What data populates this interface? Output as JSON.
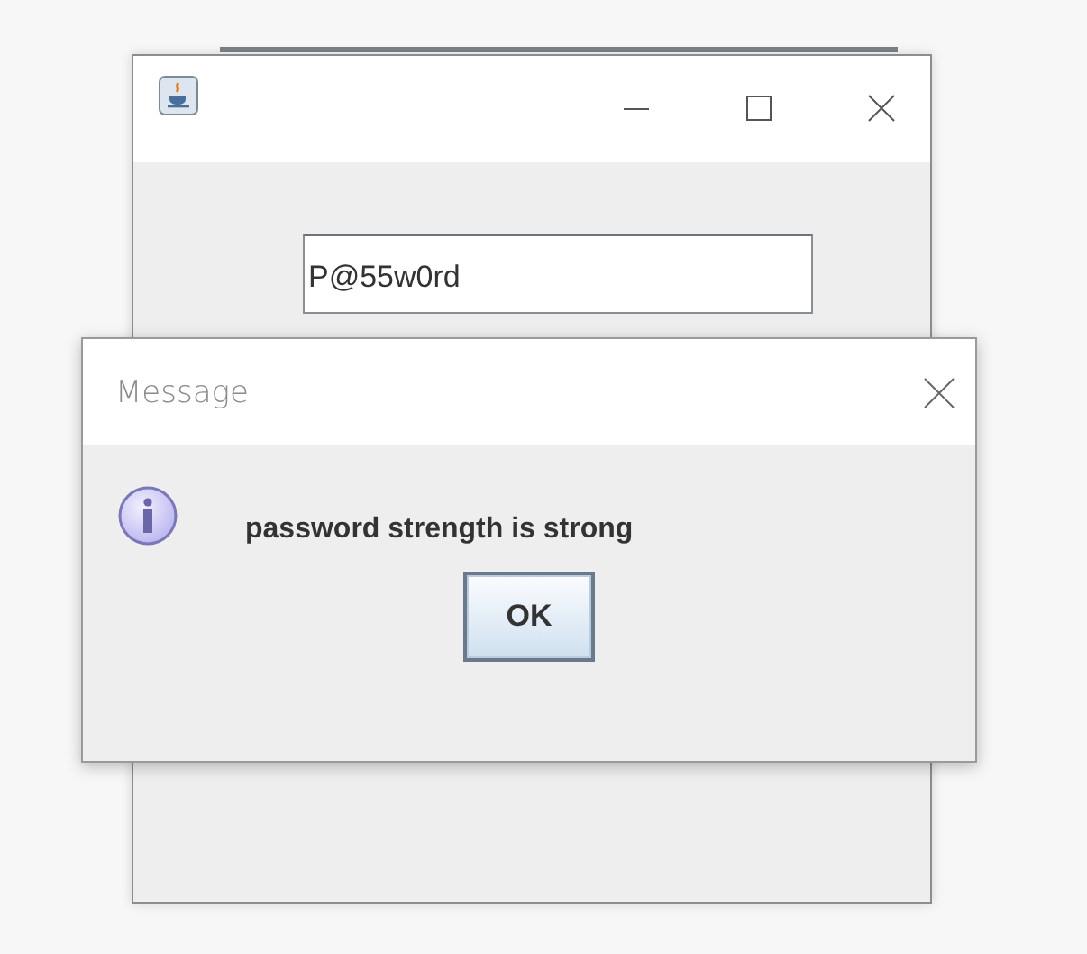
{
  "main_window": {
    "password_field": {
      "value": "P@55w0rd"
    }
  },
  "dialog": {
    "title": "Message",
    "kind": "information",
    "message": "password strength is strong",
    "buttons": [
      {
        "label": "OK",
        "focused": true
      }
    ]
  }
}
